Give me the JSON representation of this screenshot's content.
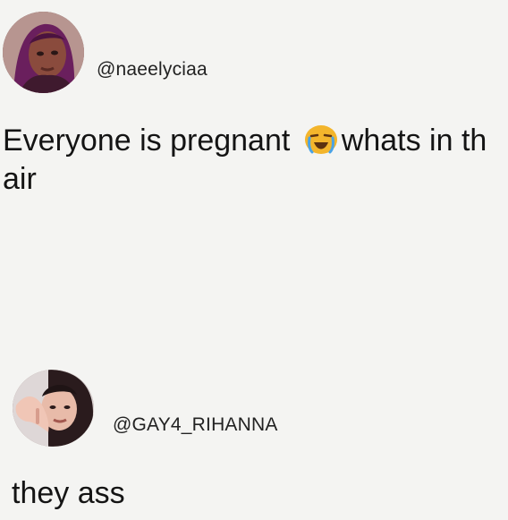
{
  "posts": [
    {
      "handle": "@naeelyciaa",
      "text_before_emoji": "Everyone is pregnant ",
      "emoji": "loudly-crying-face-icon",
      "text_after_emoji": "whats in th",
      "text_line2": "air"
    },
    {
      "handle": "@GAY4_RIHANNA",
      "text": "they ass"
    }
  ],
  "colors": {
    "background": "#f4f4f2",
    "text": "#141414",
    "emoji_yellow": "#f3b52c"
  }
}
